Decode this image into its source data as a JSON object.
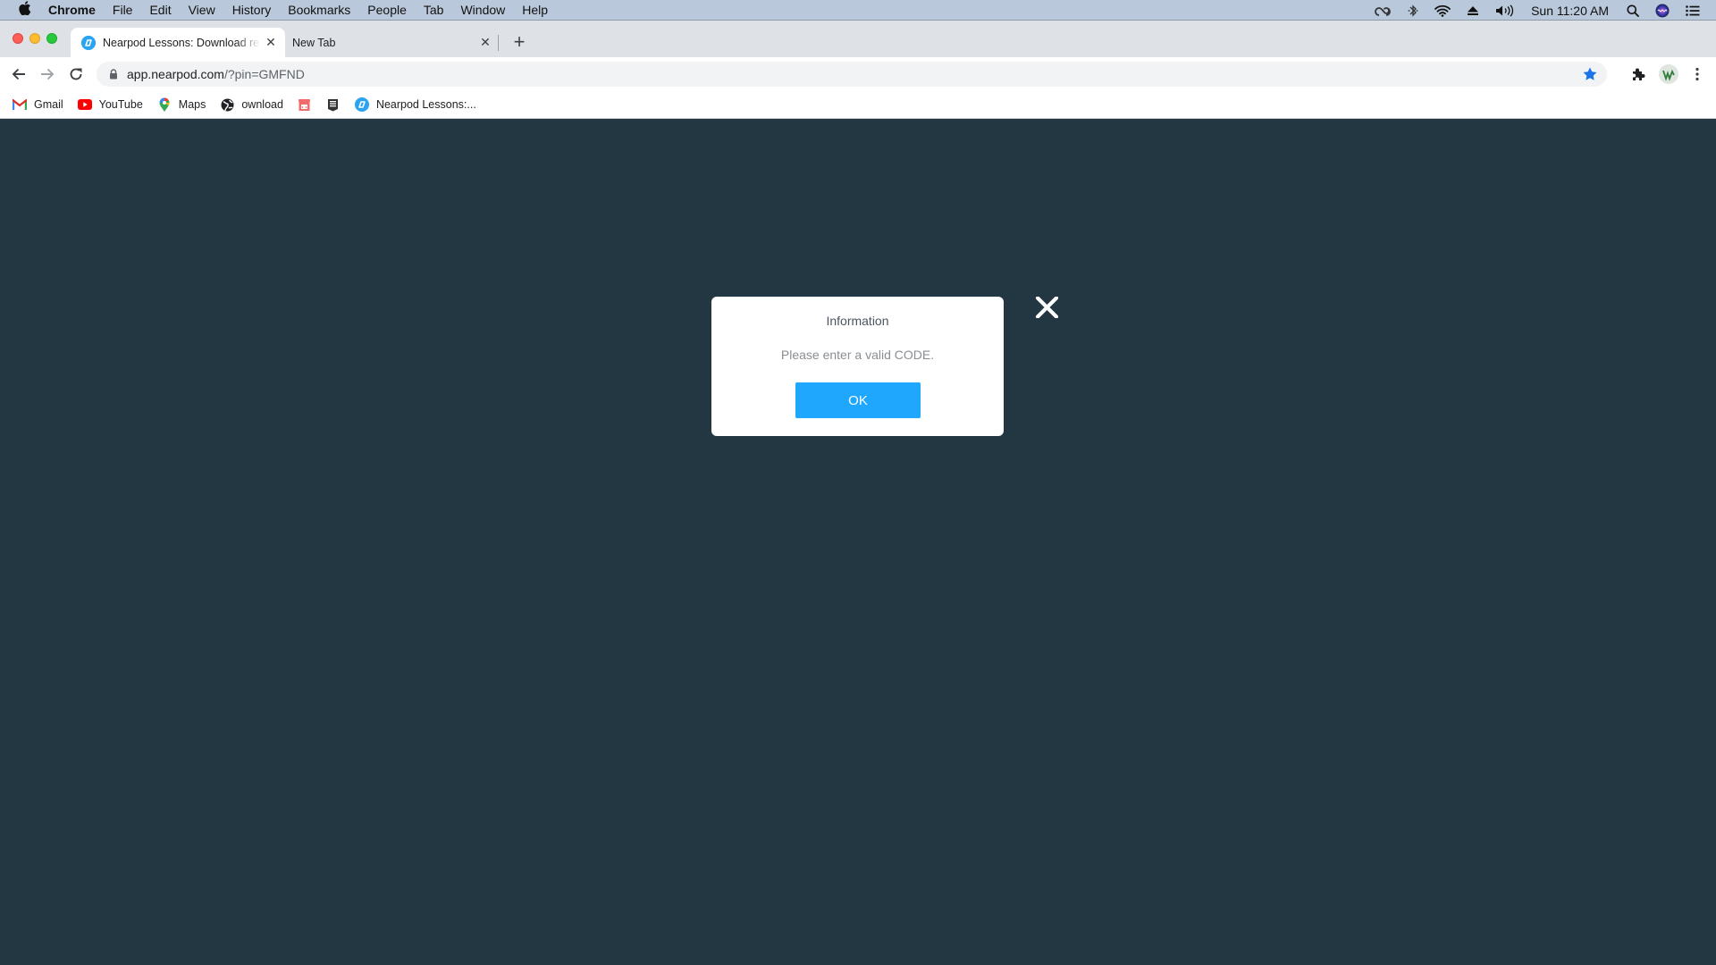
{
  "menubar": {
    "app_name": "Chrome",
    "items": [
      "File",
      "Edit",
      "View",
      "History",
      "Bookmarks",
      "People",
      "Tab",
      "Window",
      "Help"
    ],
    "clock": "Sun 11:20 AM",
    "status_icons": [
      "creative-cloud-icon",
      "bluetooth-icon",
      "wifi-icon",
      "eject-icon",
      "volume-icon",
      "spotlight-search-icon",
      "siri-icon",
      "control-center-icon"
    ]
  },
  "tabs": [
    {
      "title": "Nearpod Lessons: Download ready-to-teach lessons",
      "active": true
    },
    {
      "title": "New Tab",
      "active": false
    }
  ],
  "toolbar": {
    "url_host": "app.nearpod.com",
    "url_path": "/?pin=GMFND",
    "bookmarked": true
  },
  "bookmarks": [
    {
      "label": "Gmail",
      "icon": "gmail-icon"
    },
    {
      "label": "YouTube",
      "icon": "youtube-icon"
    },
    {
      "label": "Maps",
      "icon": "maps-icon"
    },
    {
      "label": "ownload",
      "icon": "globe-icon"
    },
    {
      "label": "",
      "icon": "store-icon"
    },
    {
      "label": "",
      "icon": "epic-games-icon"
    },
    {
      "label": "Nearpod Lessons:...",
      "icon": "nearpod-icon"
    }
  ],
  "dialog": {
    "title": "Information",
    "message": "Please enter a valid CODE.",
    "ok_label": "OK"
  },
  "colors": {
    "page_bg": "#233743",
    "ok_button": "#1ea7fd",
    "bookmark_star": "#1a73e8"
  }
}
